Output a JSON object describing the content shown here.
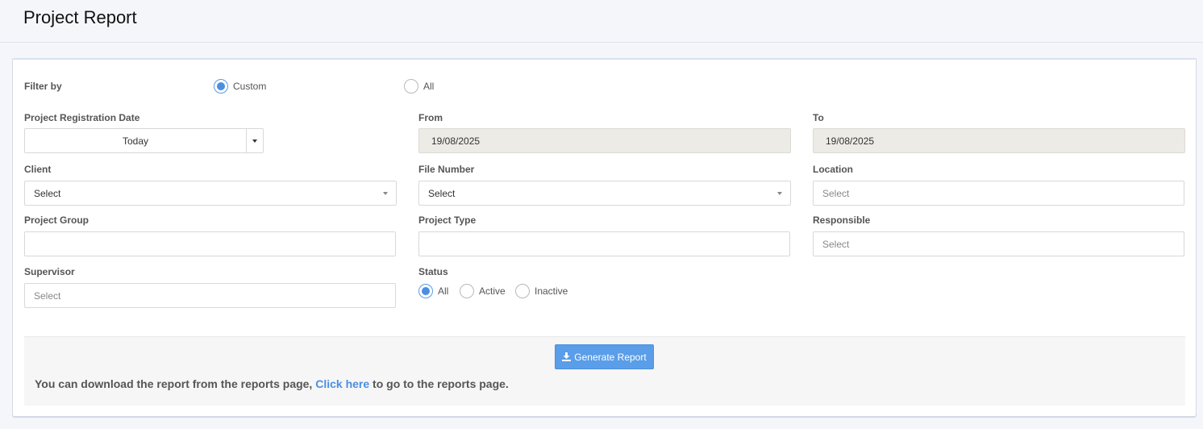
{
  "page": {
    "title": "Project Report"
  },
  "filter": {
    "label": "Filter by",
    "options": [
      {
        "label": "Custom",
        "checked": true
      },
      {
        "label": "All",
        "checked": false
      }
    ]
  },
  "fields": {
    "registration_date": {
      "label": "Project Registration Date",
      "value": "Today"
    },
    "from": {
      "label": "From",
      "value": "19/08/2025"
    },
    "to": {
      "label": "To",
      "value": "19/08/2025"
    },
    "client": {
      "label": "Client",
      "value": "Select"
    },
    "file_number": {
      "label": "File Number",
      "value": "Select"
    },
    "location": {
      "label": "Location",
      "placeholder": "Select"
    },
    "project_group": {
      "label": "Project Group",
      "value": ""
    },
    "project_type": {
      "label": "Project Type",
      "value": ""
    },
    "responsible": {
      "label": "Responsible",
      "placeholder": "Select"
    },
    "supervisor": {
      "label": "Supervisor",
      "placeholder": "Select"
    }
  },
  "status": {
    "label": "Status",
    "options": [
      {
        "label": "All",
        "checked": true
      },
      {
        "label": "Active",
        "checked": false
      },
      {
        "label": "Inactive",
        "checked": false
      }
    ]
  },
  "footer": {
    "generate_label": "Generate Report",
    "note_before": "You can download the report from the reports page, ",
    "note_link": "Click here",
    "note_after": " to go to the reports page."
  },
  "colors": {
    "accent": "#4a8fe2",
    "button": "#5a9de8",
    "readonly_bg": "#ecebe6"
  }
}
